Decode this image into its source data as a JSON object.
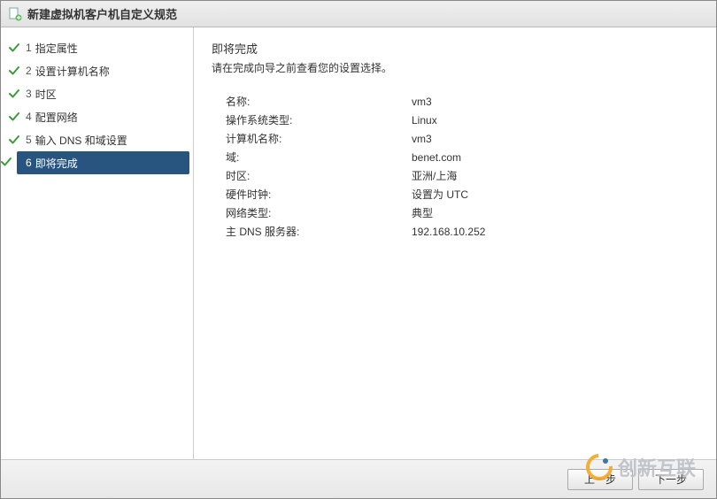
{
  "title": "新建虚拟机客户机自定义规范",
  "sidebar": {
    "steps": [
      {
        "num": "1",
        "label": "指定属性",
        "done": true,
        "active": false
      },
      {
        "num": "2",
        "label": "设置计算机名称",
        "done": true,
        "active": false
      },
      {
        "num": "3",
        "label": "时区",
        "done": true,
        "active": false
      },
      {
        "num": "4",
        "label": "配置网络",
        "done": true,
        "active": false
      },
      {
        "num": "5",
        "label": "输入 DNS 和域设置",
        "done": true,
        "active": false
      },
      {
        "num": "6",
        "label": "即将完成",
        "done": true,
        "active": true
      }
    ]
  },
  "main": {
    "title": "即将完成",
    "subtitle": "请在完成向导之前查看您的设置选择。",
    "summary": [
      {
        "k": "名称:",
        "v": "vm3"
      },
      {
        "k": "操作系统类型:",
        "v": "Linux"
      },
      {
        "k": "计算机名称:",
        "v": "vm3"
      },
      {
        "k": "域:",
        "v": "benet.com"
      },
      {
        "k": "时区:",
        "v": "亚洲/上海"
      },
      {
        "k": "硬件时钟:",
        "v": "设置为 UTC"
      },
      {
        "k": "网络类型:",
        "v": "典型"
      },
      {
        "k": "主 DNS 服务器:",
        "v": "192.168.10.252"
      }
    ]
  },
  "footer": {
    "back": "上一步",
    "next": "下一步"
  },
  "watermark": "创新互联"
}
